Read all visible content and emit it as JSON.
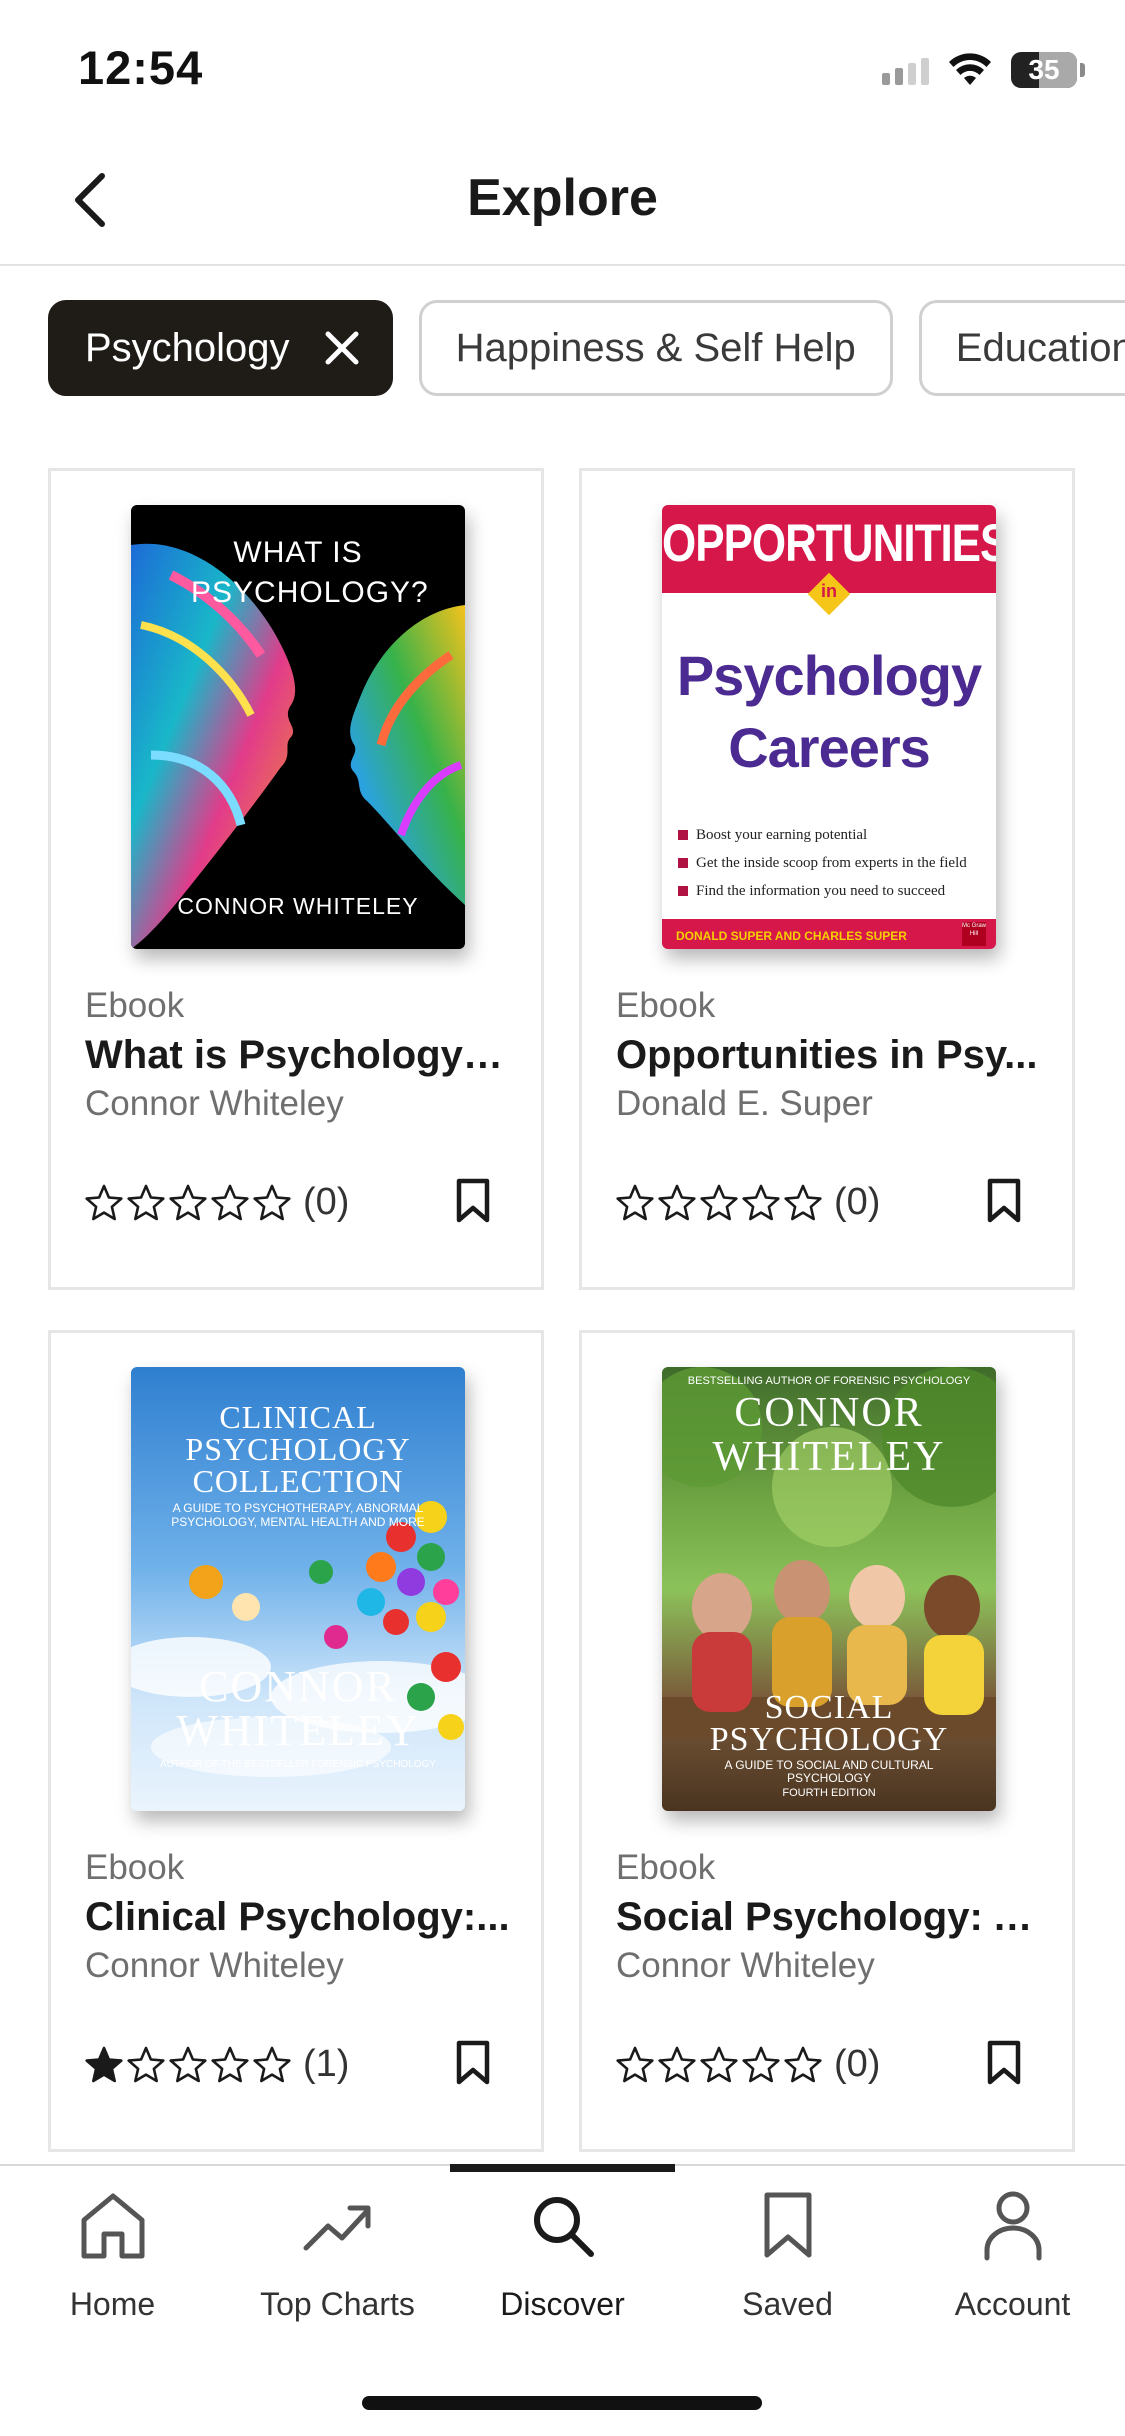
{
  "status_bar": {
    "time": "12:54",
    "battery": "35"
  },
  "header": {
    "title": "Explore"
  },
  "chips": [
    {
      "label": "Psychology",
      "active": true
    },
    {
      "label": "Happiness & Self Help",
      "active": false
    },
    {
      "label": "Education",
      "active": false
    }
  ],
  "books": [
    {
      "type": "Ebook",
      "title": "What is Psychology?:...",
      "author": "Connor Whiteley",
      "rating_stars": 0,
      "rating_count": "(0)",
      "cover": {
        "title": "WHAT IS PSYCHOLOGY?",
        "author": "CONNOR WHITELEY"
      }
    },
    {
      "type": "Ebook",
      "title": "Opportunities in Psy...",
      "author": "Donald E. Super",
      "rating_stars": 0,
      "rating_count": "(0)",
      "cover": {
        "banner": "OPPORTUNITIES",
        "in": "in",
        "title_line1": "Psychology",
        "title_line2": "Careers",
        "bullets": [
          "Boost your earning potential",
          "Get the inside scoop from experts in the field",
          "Find the information you need to succeed"
        ],
        "footer": "Donald Super and Charles Super",
        "publisher": "Mc Graw Hill"
      }
    },
    {
      "type": "Ebook",
      "title": "Clinical Psychology:...",
      "author": "Connor Whiteley",
      "rating_stars": 1,
      "rating_count": "(1)",
      "cover": {
        "title_line1": "CLINICAL",
        "title_line2": "PSYCHOLOGY",
        "title_line3": "COLLECTION",
        "subtitle": "A GUIDE TO PSYCHOTHERAPY, ABNORMAL PSYCHOLOGY, MENTAL HEALTH AND MORE",
        "author_line1": "CONNOR",
        "author_line2": "WHITELEY",
        "tagline": "AUTHOR OF THE BESTSELLER FORENSIC PSYCHOLOGY"
      }
    },
    {
      "type": "Ebook",
      "title": "Social Psychology: A...",
      "author": "Connor Whiteley",
      "rating_stars": 0,
      "rating_count": "(0)",
      "cover": {
        "tagline": "BESTSELLING AUTHOR OF FORENSIC PSYCHOLOGY",
        "author_line1": "CONNOR",
        "author_line2": "WHITELEY",
        "title_line1": "SOCIAL",
        "title_line2": "PSYCHOLOGY",
        "subtitle": "A GUIDE TO SOCIAL AND CULTURAL PSYCHOLOGY",
        "edition": "FOURTH EDITION"
      }
    }
  ],
  "tab_bar": {
    "active": "Discover",
    "tabs": [
      {
        "label": "Home",
        "icon": "home-icon"
      },
      {
        "label": "Top Charts",
        "icon": "trending-icon"
      },
      {
        "label": "Discover",
        "icon": "search-icon"
      },
      {
        "label": "Saved",
        "icon": "bookmark-icon"
      },
      {
        "label": "Account",
        "icon": "person-icon"
      }
    ]
  },
  "colors": {
    "chip_active_bg": "#1f1c17",
    "accent_red": "#d6174a",
    "accent_purple": "#4b2a91"
  }
}
